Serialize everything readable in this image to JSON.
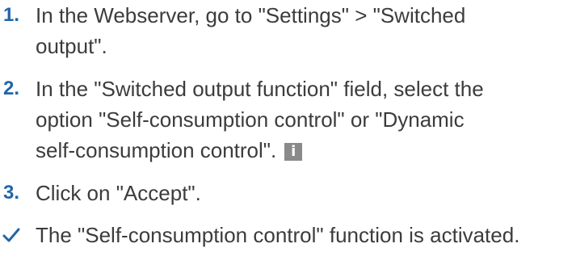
{
  "steps": [
    {
      "number": "1.",
      "lines": [
        "In the Webserver, go to \"Settings\" > \"Switched",
        "output\"."
      ]
    },
    {
      "number": "2.",
      "lines": [
        "In the \"Switched output function\" field, select the",
        "option \"Self-consumption control\" or \"Dynamic",
        "self-consumption control\"."
      ],
      "icon": "info-icon"
    },
    {
      "number": "3.",
      "lines": [
        "Click on \"Accept\"."
      ]
    }
  ],
  "result": {
    "icon": "checkmark-icon",
    "text": "The \"Self-consumption control\" function is activated."
  },
  "colors": {
    "step_number": "#2166a8",
    "text": "#3c3c3c",
    "info_icon_bg": "#8a8a8a",
    "checkmark": "#2166a8"
  }
}
